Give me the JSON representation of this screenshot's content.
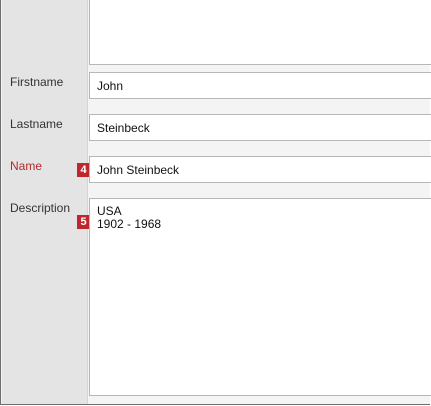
{
  "form": {
    "firstname": {
      "label": "Firstname",
      "value": "John"
    },
    "lastname": {
      "label": "Lastname",
      "value": "Steinbeck"
    },
    "name": {
      "label": "Name",
      "value": "John Steinbeck",
      "badge": "4"
    },
    "description": {
      "label": "Description",
      "value": "USA\n1902 - 1968",
      "badge": "5"
    }
  },
  "colors": {
    "required_label": "#b5272d",
    "badge": "#c0272d",
    "label_column": "#e4e4e4"
  }
}
